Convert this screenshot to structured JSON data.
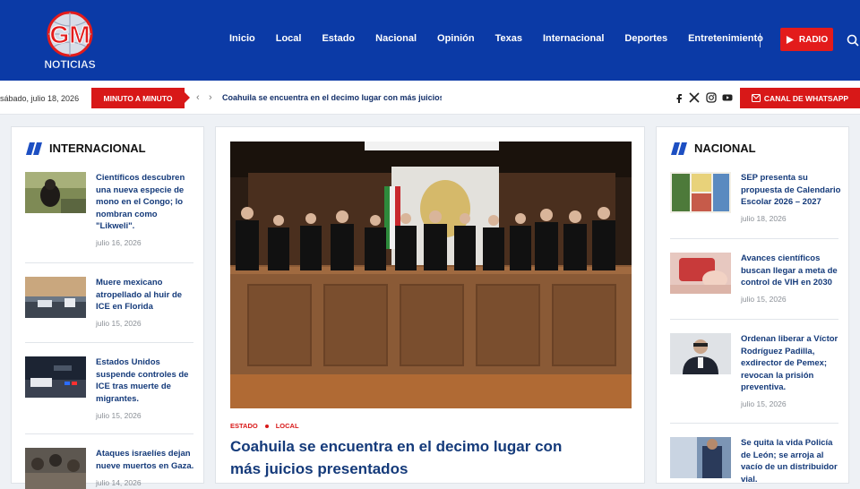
{
  "brand": {
    "logo_line1": "GM",
    "logo_line2": "NOTICIAS"
  },
  "nav": [
    "Inicio",
    "Local",
    "Estado",
    "Nacional",
    "Opinión",
    "Texas",
    "Internacional",
    "Deportes",
    "Entretenimiento"
  ],
  "radio_label": "RADIO",
  "topbar": {
    "date": "sábado, julio 18, 2026",
    "minuto_label": "MINUTO A MINUTO",
    "ticker": "Coahuila se encuentra en el decimo lugar con más juicios pre",
    "whatsapp_label": "CANAL DE WHATSAPP"
  },
  "left_panel": {
    "title": "INTERNACIONAL",
    "items": [
      {
        "title": "Científicos descubren una nueva especie de mono en el Congo; lo nombran como \"Likweli\".",
        "date": "julio 16, 2026"
      },
      {
        "title": "Muere mexicano atropellado al huir de ICE en Florida",
        "date": "julio 15, 2026"
      },
      {
        "title": "Estados Unidos suspende controles de ICE tras muerte de migrantes.",
        "date": "julio 15, 2026"
      },
      {
        "title": "Ataques israelíes dejan nueve muertos en Gaza.",
        "date": "julio 14, 2026"
      }
    ]
  },
  "right_panel": {
    "title": "NACIONAL",
    "items": [
      {
        "title": "SEP presenta su propuesta de Calendario Escolar 2026 – 2027",
        "date": "julio 18, 2026"
      },
      {
        "title": "Avances científicos buscan llegar a meta de control de VIH en 2030",
        "date": "julio 15, 2026"
      },
      {
        "title": "Ordenan liberar a Víctor Rodríguez Padilla, exdirector de Pemex; revocan la prisión preventiva.",
        "date": "julio 15, 2026"
      },
      {
        "title": "Se quita la vida Policía de León; se arroja al vacío de un distribuidor vial.",
        "date": ""
      }
    ]
  },
  "main_story": {
    "categories": [
      "ESTADO",
      "LOCAL"
    ],
    "headline": "Coahuila se encuentra en el decimo lugar con más juicios presentados"
  },
  "colors": {
    "header": "#0b3aa6",
    "accent": "#d81818",
    "link": "#143a7a"
  },
  "icons": [
    "search-icon",
    "play-icon",
    "facebook-icon",
    "x-icon",
    "instagram-icon",
    "youtube-icon",
    "whatsapp-icon",
    "chevron-left-icon",
    "chevron-right-icon"
  ]
}
